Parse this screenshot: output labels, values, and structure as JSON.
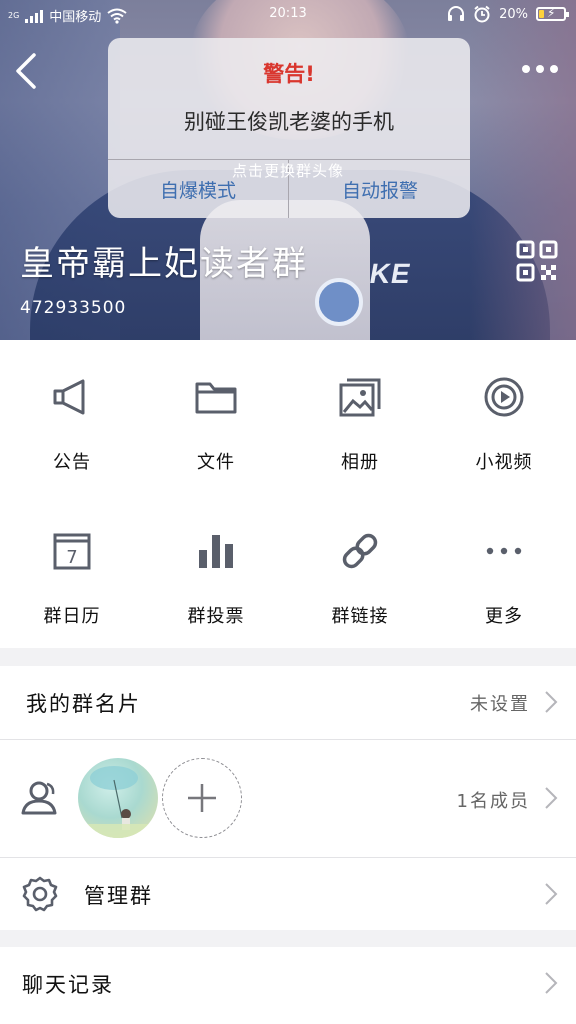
{
  "status_bar": {
    "carrier": "中国移动",
    "network_type": "2G",
    "time": "20:13",
    "battery_percent": "20%",
    "battery_level": 0.2
  },
  "header": {
    "avatar_hint": "点击更换群头像",
    "group_name": "皇帝霸上妃读者群",
    "group_id": "472933500",
    "photo_text": "KE",
    "warning": {
      "title": "警告!",
      "message": "别碰王俊凯老婆的手机",
      "left_button": "自爆模式",
      "right_button": "自动报警"
    }
  },
  "features": [
    {
      "label": "公告",
      "icon": "megaphone-icon"
    },
    {
      "label": "文件",
      "icon": "folder-icon"
    },
    {
      "label": "相册",
      "icon": "album-icon"
    },
    {
      "label": "小视频",
      "icon": "video-icon"
    },
    {
      "label": "群日历",
      "icon": "calendar-icon",
      "calendar_day": "7"
    },
    {
      "label": "群投票",
      "icon": "vote-chart-icon"
    },
    {
      "label": "群链接",
      "icon": "link-icon"
    },
    {
      "label": "更多",
      "icon": "more-dots-icon"
    }
  ],
  "list": {
    "card": {
      "label": "我的群名片",
      "value": "未设置"
    },
    "members": {
      "count_text": "1名成员"
    },
    "manage": {
      "label": "管理群"
    },
    "chat_history": {
      "label": "聊天记录"
    }
  },
  "colors": {
    "warning_title": "#d9362e",
    "warning_button": "#3f6fb0",
    "icon_gray": "#5a5f6b",
    "battery": "#ffd23c"
  }
}
